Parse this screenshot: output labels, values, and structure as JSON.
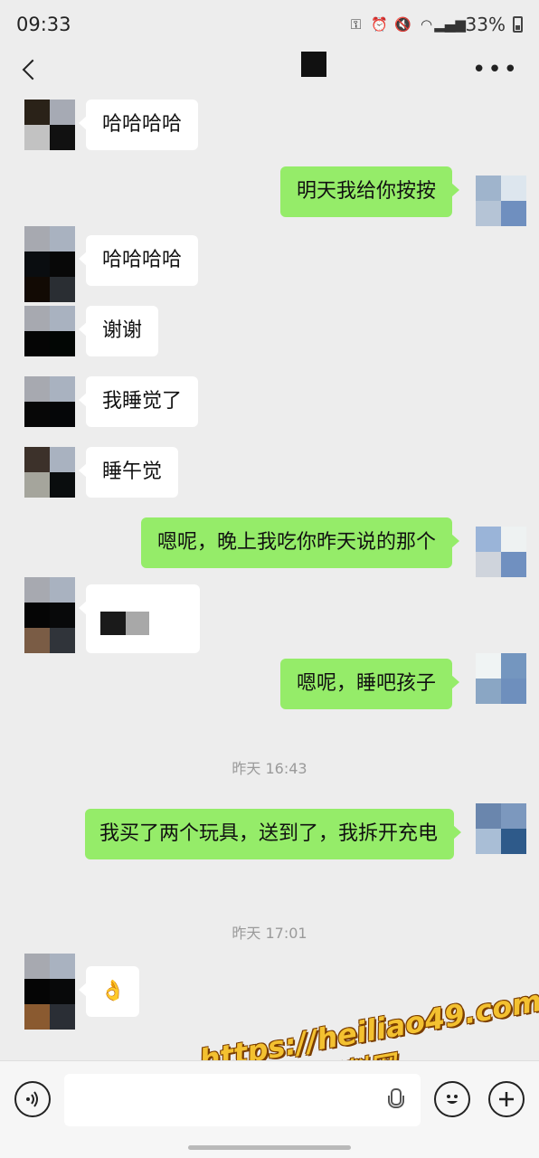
{
  "status": {
    "time": "09:33",
    "battery": "33%",
    "icons": [
      "key-icon",
      "alarm-icon",
      "mute-icon",
      "wifi-icon",
      "hd-icon",
      "signal-icon",
      "battery-icon"
    ]
  },
  "nav": {
    "back_icon": "chevron-left-icon",
    "more_icon": "more-icon"
  },
  "messages": [
    {
      "side": "in",
      "text": "哈哈哈哈"
    },
    {
      "side": "out",
      "text": "明天我给你按按"
    },
    {
      "side": "in",
      "text": "哈哈哈哈"
    },
    {
      "side": "in",
      "text": "谢谢"
    },
    {
      "side": "in",
      "text": "我睡觉了"
    },
    {
      "side": "in",
      "text": "睡午觉"
    },
    {
      "side": "out",
      "text": "嗯呢，晚上我吃你昨天说的那个"
    },
    {
      "side": "in",
      "text": ""
    },
    {
      "side": "out",
      "text": "嗯呢，睡吧孩子"
    },
    {
      "side": "out",
      "text": "我买了两个玩具，送到了，我拆开充电"
    },
    {
      "side": "in",
      "text": "👌"
    }
  ],
  "timestamps": [
    "昨天 16:43",
    "昨天 17:01"
  ],
  "input": {
    "placeholder": ""
  },
  "watermark": {
    "line1": "https://heiliao49.com",
    "line2": "黑料网"
  },
  "colors": {
    "background": "#ededed",
    "outgoing": "#95ec69",
    "incoming": "#ffffff"
  }
}
